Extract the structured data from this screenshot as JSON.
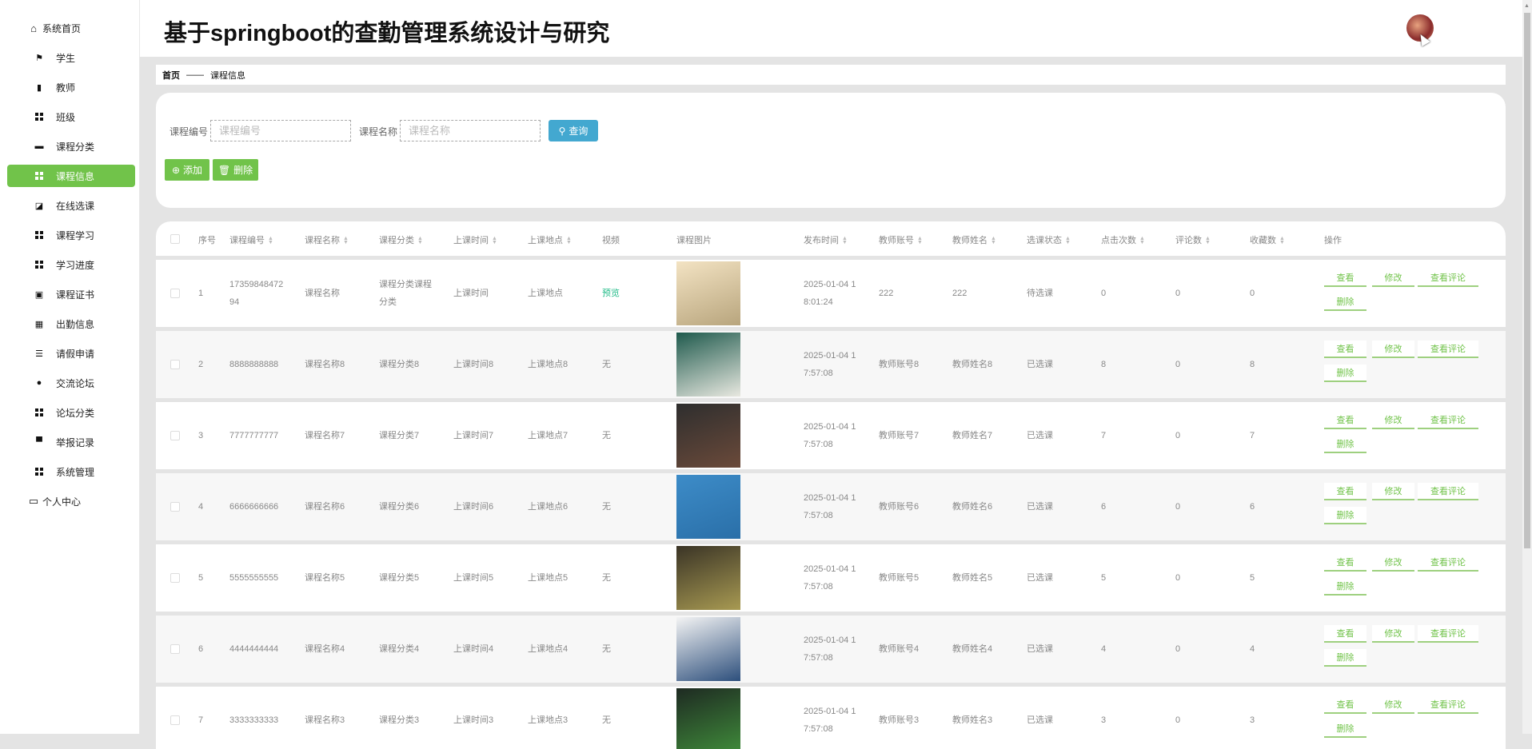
{
  "header": {
    "title": "基于springboot的查勤管理系统设计与研究"
  },
  "sidebar": {
    "items": [
      {
        "label": "系统首页",
        "icon": "home-icon",
        "glyph": "⌂",
        "top": true
      },
      {
        "label": "学生",
        "icon": "flag-icon",
        "glyph": "⚑"
      },
      {
        "label": "教师",
        "icon": "bar-chart-icon",
        "glyph": "▮"
      },
      {
        "label": "班级",
        "icon": "grid-icon",
        "glyph": "grid"
      },
      {
        "label": "课程分类",
        "icon": "briefcase-icon",
        "glyph": "▬"
      },
      {
        "label": "课程信息",
        "icon": "grid-icon",
        "glyph": "grid",
        "active": true
      },
      {
        "label": "在线选课",
        "icon": "line-chart-icon",
        "glyph": "◪"
      },
      {
        "label": "课程学习",
        "icon": "grid-icon",
        "glyph": "grid"
      },
      {
        "label": "学习进度",
        "icon": "grid-icon",
        "glyph": "grid"
      },
      {
        "label": "课程证书",
        "icon": "clipboard-icon",
        "glyph": "▣"
      },
      {
        "label": "出勤信息",
        "icon": "calendar-grid-icon",
        "glyph": "▦"
      },
      {
        "label": "请假申请",
        "icon": "list-icon",
        "glyph": "☰"
      },
      {
        "label": "交流论坛",
        "icon": "location-pin-icon",
        "glyph": "●"
      },
      {
        "label": "论坛分类",
        "icon": "grid-icon",
        "glyph": "grid"
      },
      {
        "label": "举报记录",
        "icon": "comment-icon",
        "glyph": "▀"
      },
      {
        "label": "系统管理",
        "icon": "grid-icon",
        "glyph": "grid"
      },
      {
        "label": "个人中心",
        "icon": "card-icon",
        "glyph": "▭",
        "top": true
      }
    ]
  },
  "breadcrumb": {
    "home": "首页",
    "sep": "——",
    "current": "课程信息"
  },
  "search": {
    "code_label": "课程编号",
    "code_placeholder": "课程编号",
    "code_value": "",
    "name_label": "课程名称",
    "name_placeholder": "课程名称",
    "name_value": "",
    "query_label": "查询",
    "add_label": "添加",
    "delete_label": "删除"
  },
  "table": {
    "columns": [
      "序号",
      "课程编号",
      "课程名称",
      "课程分类",
      "上课时间",
      "上课地点",
      "视频",
      "课程图片",
      "发布时间",
      "教师账号",
      "教师姓名",
      "选课状态",
      "点击次数",
      "评论数",
      "收藏数",
      "操作"
    ],
    "actions": {
      "view": "查看",
      "edit": "修改",
      "comments": "查看评论",
      "delete": "删除"
    },
    "rows": [
      {
        "index": "1",
        "code": "17359848472\n94",
        "name": "课程名称",
        "category": "课程分类课程\n分类",
        "time": "上课时间",
        "place": "上课地点",
        "video": "预览",
        "published": "2025-01-04 1\n8:01:24",
        "teacher_account": "222",
        "teacher_name": "222",
        "status": "待选课",
        "clicks": "0",
        "comments": "0",
        "favorites": "0",
        "img": [
          "#f3e3c3",
          "#b8a57d"
        ]
      },
      {
        "index": "2",
        "code": "8888888888",
        "name": "课程名称8",
        "category": "课程分类8",
        "time": "上课时间8",
        "place": "上课地点8",
        "video": "无",
        "published": "2025-01-04 1\n7:57:08",
        "teacher_account": "教师账号8",
        "teacher_name": "教师姓名8",
        "status": "已选课",
        "clicks": "8",
        "comments": "0",
        "favorites": "8",
        "img": [
          "#1f5a4d",
          "#e8e8e0"
        ]
      },
      {
        "index": "3",
        "code": "7777777777",
        "name": "课程名称7",
        "category": "课程分类7",
        "time": "上课时间7",
        "place": "上课地点7",
        "video": "无",
        "published": "2025-01-04 1\n7:57:08",
        "teacher_account": "教师账号7",
        "teacher_name": "教师姓名7",
        "status": "已选课",
        "clicks": "7",
        "comments": "0",
        "favorites": "7",
        "img": [
          "#2e2e2e",
          "#6b4a3a"
        ]
      },
      {
        "index": "4",
        "code": "6666666666",
        "name": "课程名称6",
        "category": "课程分类6",
        "time": "上课时间6",
        "place": "上课地点6",
        "video": "无",
        "published": "2025-01-04 1\n7:57:08",
        "teacher_account": "教师账号6",
        "teacher_name": "教师姓名6",
        "status": "已选课",
        "clicks": "6",
        "comments": "0",
        "favorites": "6",
        "img": [
          "#3d8cc8",
          "#2a6fa8"
        ]
      },
      {
        "index": "5",
        "code": "5555555555",
        "name": "课程名称5",
        "category": "课程分类5",
        "time": "上课时间5",
        "place": "上课地点5",
        "video": "无",
        "published": "2025-01-04 1\n7:57:08",
        "teacher_account": "教师账号5",
        "teacher_name": "教师姓名5",
        "status": "已选课",
        "clicks": "5",
        "comments": "0",
        "favorites": "5",
        "img": [
          "#3a3426",
          "#a89a52"
        ]
      },
      {
        "index": "6",
        "code": "4444444444",
        "name": "课程名称4",
        "category": "课程分类4",
        "time": "上课时间4",
        "place": "上课地点4",
        "video": "无",
        "published": "2025-01-04 1\n7:57:08",
        "teacher_account": "教师账号4",
        "teacher_name": "教师姓名4",
        "status": "已选课",
        "clicks": "4",
        "comments": "0",
        "favorites": "4",
        "img": [
          "#f4f4f4",
          "#2d4f7c"
        ]
      },
      {
        "index": "7",
        "code": "3333333333",
        "name": "课程名称3",
        "category": "课程分类3",
        "time": "上课时间3",
        "place": "上课地点3",
        "video": "无",
        "published": "2025-01-04 1\n7:57:08",
        "teacher_account": "教师账号3",
        "teacher_name": "教师姓名3",
        "status": "已选课",
        "clicks": "3",
        "comments": "0",
        "favorites": "3",
        "img": [
          "#1e2a22",
          "#3f8a3a"
        ]
      }
    ]
  }
}
